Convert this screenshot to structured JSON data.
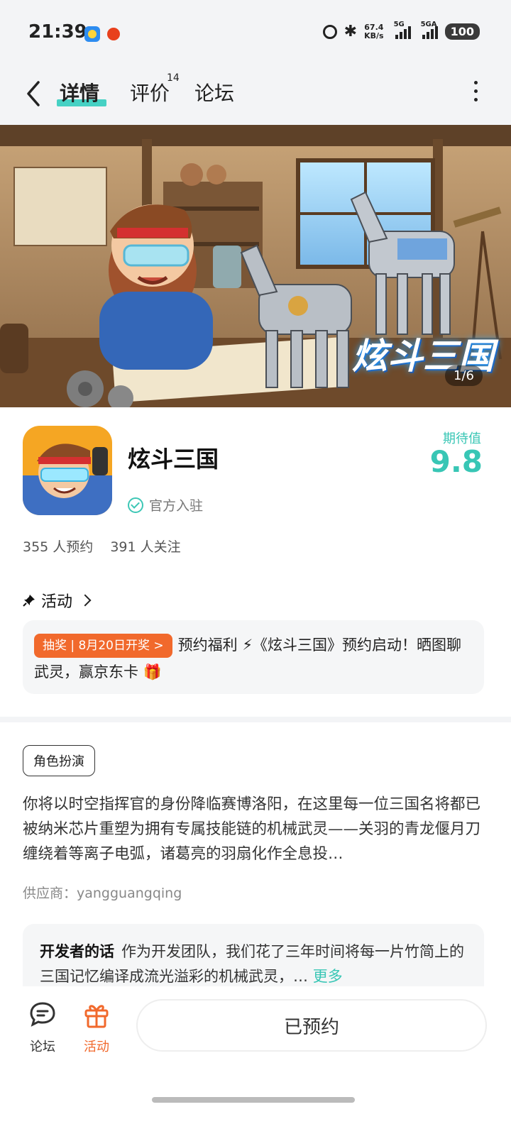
{
  "status_bar": {
    "time": "21:39",
    "speed_value": "67.4",
    "speed_unit": "KB/s",
    "sig1": "5G",
    "sig2": "5GA",
    "battery": "100"
  },
  "nav": {
    "tabs": [
      {
        "label": "详情"
      },
      {
        "label": "评价"
      },
      {
        "label": "论坛"
      }
    ],
    "review_count": "14"
  },
  "hero": {
    "counter": "1/6",
    "logo_text": "炫斗三国"
  },
  "app": {
    "name": "炫斗三国",
    "official": "官方入驻",
    "expect_label": "期待值",
    "expect_value": "9.8",
    "reservations": "355 人预约",
    "follows": "391 人关注"
  },
  "activity": {
    "heading": "活动",
    "badge": "抽奖 | 8月20日开奖 >",
    "text": "预约福利 ⚡《炫斗三国》预约启动！晒图聊武灵，赢京东卡 🎁"
  },
  "description": {
    "tag": "角色扮演",
    "text": "你将以时空指挥官的身份降临赛博洛阳，在这里每一位三国名将都已被纳米芯片重塑为拥有专属技能链的机械武灵——关羽的青龙偃月刀缠绕着等离子电弧，诸葛亮的羽扇化作全息投…",
    "supplier": "供应商：yangguangqing",
    "dev_title": "开发者的话",
    "dev_text": "作为开发团队，我们花了三年时间将每一片竹简上的三国记忆编译成流光溢彩的机械武灵，…",
    "dev_more": "更多"
  },
  "bottom": {
    "forum_label": "论坛",
    "activity_label": "活动",
    "reserve_label": "已预约"
  },
  "colors": {
    "accent": "#38c6b5",
    "orange": "#f1692c"
  }
}
